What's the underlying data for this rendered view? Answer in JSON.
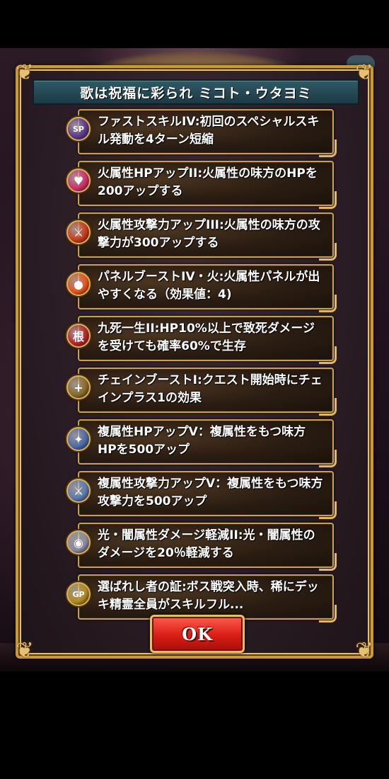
{
  "dialog": {
    "title": "歌は祝福に彩られ ミコト・ウタヨミ",
    "ok_label": "OK"
  },
  "skills": [
    {
      "icon": "skill-swirl-icon",
      "icon_text": "SP",
      "color": "#5a3a8a",
      "text": "ファストスキルIV:初回のスペシャルスキル発動を4ターン短縮"
    },
    {
      "icon": "heart-icon",
      "icon_text": "♥",
      "color": "#d0306a",
      "text": "火属性HPアップII:火属性の味方のHPを200アップする"
    },
    {
      "icon": "sword-icon",
      "icon_text": "⚔",
      "color": "#c83a1a",
      "text": "火属性攻撃力アップIII:火属性の味方の攻撃力が300アップする"
    },
    {
      "icon": "fire-orb-icon",
      "icon_text": "●",
      "color": "#e8541a",
      "text": "パネルブーストIV・火:火属性パネルが出やすくなる（効果値：4)"
    },
    {
      "icon": "kanji-badge-icon",
      "icon_text": "根",
      "color": "#b8242a",
      "text": "九死一生II:HP10%以上で致死ダメージを受けても確率60%で生存"
    },
    {
      "icon": "chain-icon",
      "icon_text": "+",
      "color": "#8a6a2a",
      "text": "チェインブーストI:クエスト開始時にチェインプラス1の効果"
    },
    {
      "icon": "multi-element-heart-icon",
      "icon_text": "✦",
      "color": "#4a6aa8",
      "text": "複属性HPアップV：複属性をもつ味方HPを500アップ"
    },
    {
      "icon": "multi-element-sword-icon",
      "icon_text": "⚔",
      "color": "#5a7ab0",
      "text": "複属性攻撃力アップV：複属性をもつ味方攻撃力を500アップ"
    },
    {
      "icon": "light-dark-icon",
      "icon_text": "◉",
      "color": "#8a8aa0",
      "text": "光・闇属性ダメージ軽減II:光・闇属性のダメージを20％軽減する"
    },
    {
      "icon": "gp-badge-icon",
      "icon_text": "GP",
      "color": "#b08a20",
      "text": "選ばれし者の証:ボス戦突入時、稀にデッキ精霊全員がスキルフル..."
    }
  ]
}
